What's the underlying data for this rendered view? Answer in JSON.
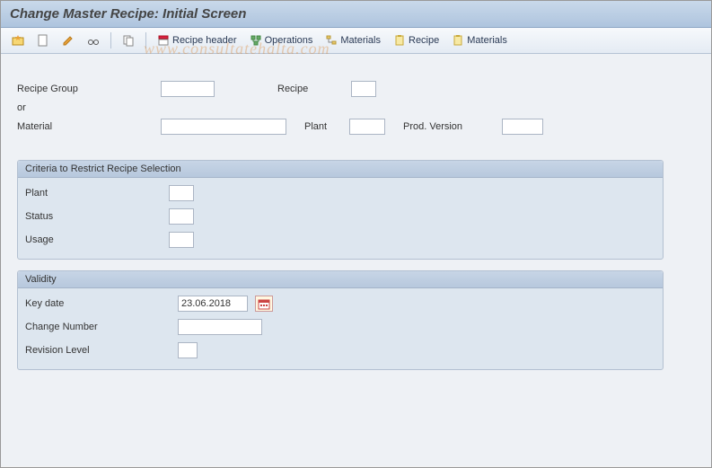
{
  "title": "Change Master Recipe: Initial Screen",
  "toolbar": {
    "recipe_header": "Recipe header",
    "operations": "Operations",
    "materials1": "Materials",
    "recipe": "Recipe",
    "materials2": "Materials"
  },
  "top_fields": {
    "recipe_group_label": "Recipe Group",
    "recipe_group_value": "",
    "recipe_label": "Recipe",
    "recipe_value": "",
    "or_label": "or",
    "material_label": "Material",
    "material_value": "",
    "plant_label": "Plant",
    "plant_value": "",
    "prod_version_label": "Prod. Version",
    "prod_version_value": ""
  },
  "criteria": {
    "title": "Criteria to Restrict Recipe Selection",
    "plant_label": "Plant",
    "plant_value": "",
    "status_label": "Status",
    "status_value": "",
    "usage_label": "Usage",
    "usage_value": ""
  },
  "validity": {
    "title": "Validity",
    "key_date_label": "Key date",
    "key_date_value": "23.06.2018",
    "change_number_label": "Change Number",
    "change_number_value": "",
    "revision_level_label": "Revision Level",
    "revision_level_value": ""
  },
  "watermark": "www.consultatehalta.com"
}
